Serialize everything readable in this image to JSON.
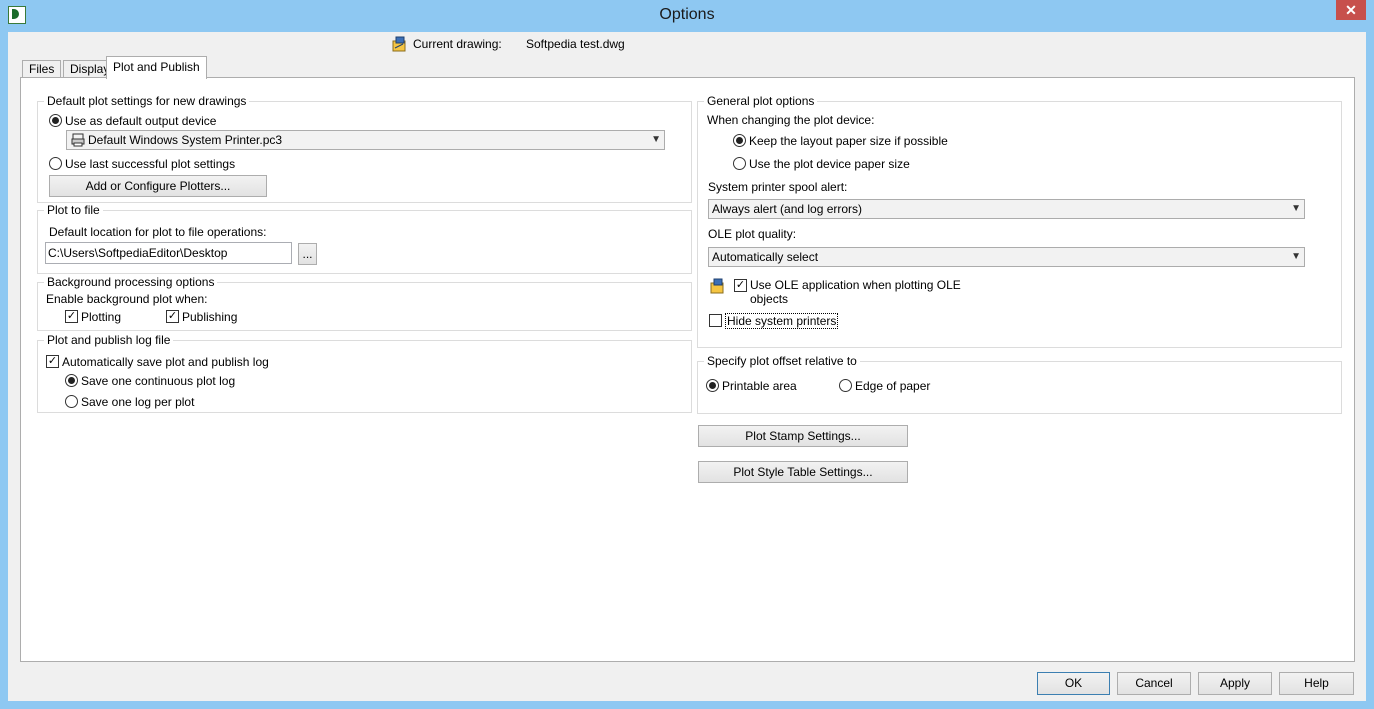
{
  "window": {
    "title": "Options",
    "close_glyph": "✕"
  },
  "current_drawing": {
    "label": "Current drawing:",
    "value": "Softpedia test.dwg"
  },
  "tabs": [
    {
      "label": "Files"
    },
    {
      "label": "Display"
    },
    {
      "label": "Plot and Publish"
    }
  ],
  "default_plot": {
    "title": "Default plot settings for new drawings",
    "use_default_label": "Use as default output device",
    "device_value": "Default Windows System Printer.pc3",
    "use_last_label": "Use last successful plot settings",
    "add_plotters_label": "Add or Configure Plotters..."
  },
  "plot_to_file": {
    "title": "Plot to file",
    "location_label": "Default location for plot to file operations:",
    "location_value": "C:\\Users\\SoftpediaEditor\\Desktop",
    "browse_label": "..."
  },
  "background": {
    "title": "Background processing options",
    "enable_label": "Enable background plot when:",
    "plotting_label": "Plotting",
    "publishing_label": "Publishing"
  },
  "log": {
    "title": "Plot and publish log file",
    "auto_save_label": "Automatically save plot and publish log",
    "continuous_label": "Save one continuous plot log",
    "per_plot_label": "Save one log per plot"
  },
  "general": {
    "title": "General plot options",
    "changing_label": "When changing the plot device:",
    "keep_layout_label": "Keep the layout paper size if possible",
    "use_device_label": "Use the plot device paper size",
    "spool_label": "System printer spool alert:",
    "spool_value": "Always alert (and log errors)",
    "ole_quality_label": "OLE plot quality:",
    "ole_quality_value": "Automatically select",
    "use_ole_label_line1": "Use OLE application when plotting OLE",
    "use_ole_label_line2": "objects",
    "hide_printers_label": "Hide system printers"
  },
  "offset": {
    "title": "Specify plot offset relative to",
    "printable_label": "Printable area",
    "edge_label": "Edge of paper"
  },
  "buttons": {
    "stamp": "Plot Stamp Settings...",
    "style_table": "Plot Style Table Settings...",
    "ok": "OK",
    "cancel": "Cancel",
    "apply": "Apply",
    "help": "Help"
  },
  "colors": {
    "titlebar": "#8ec8f2",
    "close": "#c7504c"
  }
}
